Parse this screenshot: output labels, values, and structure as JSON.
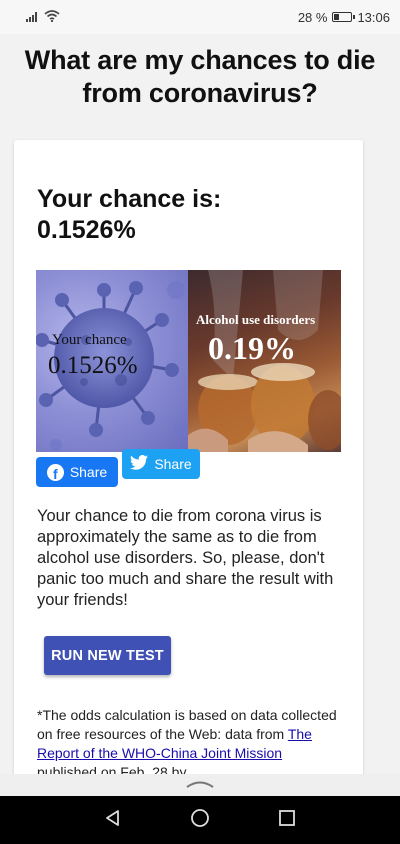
{
  "status_bar": {
    "battery_percent": "28 %",
    "time": "13:06"
  },
  "page": {
    "title": "What are my chances to die from coronavirus?"
  },
  "result": {
    "heading": "Your chance is:",
    "value": "0.1526%"
  },
  "comparison_image": {
    "left_label": "Your chance",
    "left_value": "0.1526%",
    "right_label": "Alcohol use disorders",
    "right_value": "0.19%"
  },
  "share": {
    "facebook_label": "Share",
    "twitter_label": "Share"
  },
  "explanation": "Your chance to die from corona virus is approximately the same as to die from alcohol use disorders. So, please, don't panic too much and share the result with your friends!",
  "run_button_label": "RUN NEW TEST",
  "footnote": {
    "prefix": "*The odds calculation is based on data collected on free resources of the Web: data from ",
    "link_text": "The Report of the WHO-China Joint Mission",
    "suffix": " published on Feb. 28 by"
  },
  "colors": {
    "facebook": "#1877f2",
    "twitter": "#1da1f2",
    "primary_button": "#3f51b5",
    "link": "#1a0dab"
  },
  "icons": [
    "signal-icon",
    "wifi-icon",
    "battery-icon",
    "facebook-icon",
    "twitter-icon",
    "chevron-up-icon",
    "back-icon",
    "home-icon",
    "recents-icon"
  ]
}
